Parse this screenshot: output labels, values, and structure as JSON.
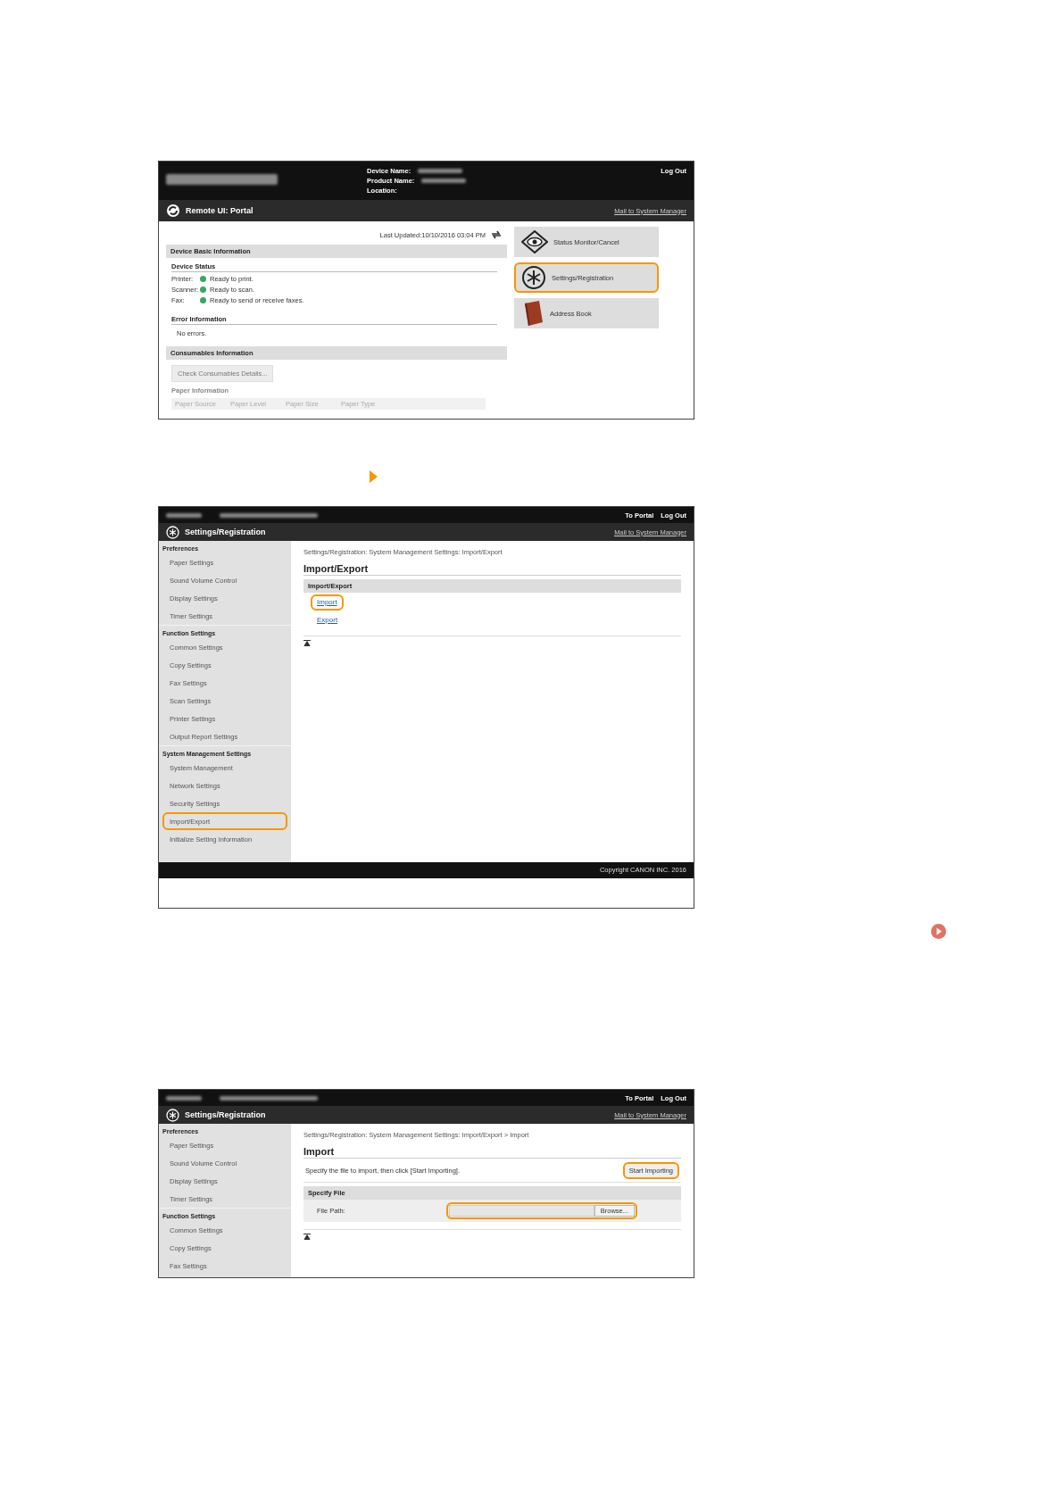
{
  "portal_screen": {
    "device_labels": [
      "Device Name:",
      "Product Name:",
      "Location:"
    ],
    "logout": "Log Out",
    "title": "Remote UI: Portal",
    "mail_link": "Mail to System Manager",
    "last_updated": "Last Updated:10/10/2016 03:04 PM",
    "basic_info": {
      "heading": "Device Basic Information",
      "status_heading": "Device Status",
      "status_rows": [
        {
          "label": "Printer:",
          "status": "Ready to print."
        },
        {
          "label": "Scanner:",
          "status": "Ready to scan."
        },
        {
          "label": "Fax:",
          "status": "Ready to send or receive faxes."
        }
      ],
      "error_heading": "Error Information",
      "error_text": "No errors."
    },
    "consumables": {
      "heading": "Consumables Information",
      "button": "Check Consumables Details...",
      "paper_heading": "Paper Information",
      "columns": [
        "Paper Source",
        "Paper Level",
        "Paper Size",
        "Paper Type"
      ]
    },
    "menu": [
      {
        "kind": "status",
        "label": "Status Monitor/Cancel",
        "highlighted": false
      },
      {
        "kind": "settings",
        "label": "Settings/Registration",
        "highlighted": true
      },
      {
        "kind": "address",
        "label": "Address Book",
        "highlighted": false
      }
    ]
  },
  "import_export_screen": {
    "nav": [
      "To Portal",
      "Log Out"
    ],
    "title": "Settings/Registration",
    "mail_link": "Mail to System Manager",
    "sidebar": [
      {
        "heading": "Preferences",
        "items": [
          {
            "label": "Paper Settings",
            "highlighted": false
          },
          {
            "label": "Sound Volume Control",
            "highlighted": false
          },
          {
            "label": "Display Settings",
            "highlighted": false
          },
          {
            "label": "Timer Settings",
            "highlighted": false
          }
        ]
      },
      {
        "heading": "Function Settings",
        "items": [
          {
            "label": "Common Settings",
            "highlighted": false
          },
          {
            "label": "Copy Settings",
            "highlighted": false
          },
          {
            "label": "Fax Settings",
            "highlighted": false
          },
          {
            "label": "Scan Settings",
            "highlighted": false
          },
          {
            "label": "Printer Settings",
            "highlighted": false
          },
          {
            "label": "Output Report Settings",
            "highlighted": false
          }
        ]
      },
      {
        "heading": "System Management Settings",
        "items": [
          {
            "label": "System Management",
            "highlighted": false
          },
          {
            "label": "Network Settings",
            "highlighted": false
          },
          {
            "label": "Security Settings",
            "highlighted": false
          },
          {
            "label": "Import/Export",
            "highlighted": true
          },
          {
            "label": "Initialize Setting Information",
            "highlighted": false
          }
        ]
      }
    ],
    "breadcrumb": "Settings/Registration: System Management Settings: Import/Export",
    "page_title": "Import/Export",
    "section": {
      "kind": "links",
      "heading": "Import/Export",
      "links": [
        {
          "label": "Import",
          "highlighted": true
        },
        {
          "label": "Export",
          "highlighted": false
        }
      ]
    },
    "footer": "Copyright CANON INC. 2016"
  },
  "import_screen": {
    "nav": [
      "To Portal",
      "Log Out"
    ],
    "title": "Settings/Registration",
    "mail_link": "Mail to System Manager",
    "sidebar": [
      {
        "heading": "Preferences",
        "items": [
          {
            "label": "Paper Settings",
            "highlighted": false
          },
          {
            "label": "Sound Volume Control",
            "highlighted": false
          },
          {
            "label": "Display Settings",
            "highlighted": false
          },
          {
            "label": "Timer Settings",
            "highlighted": false
          }
        ]
      },
      {
        "heading": "Function Settings",
        "items": [
          {
            "label": "Common Settings",
            "highlighted": false
          },
          {
            "label": "Copy Settings",
            "highlighted": false
          },
          {
            "label": "Fax Settings",
            "highlighted": false
          }
        ]
      }
    ],
    "breadcrumb": "Settings/Registration: System Management Settings: Import/Export > Import",
    "page_title": "Import",
    "section": {
      "kind": "form",
      "instruction": "Specify the file to import, then click [Start Importing].",
      "start_button": {
        "label": "Start Importing",
        "highlighted": true
      },
      "heading": "Specify File",
      "field_label": "File Path:",
      "file_field": {
        "browse": "Browse...",
        "highlighted": true
      }
    }
  }
}
